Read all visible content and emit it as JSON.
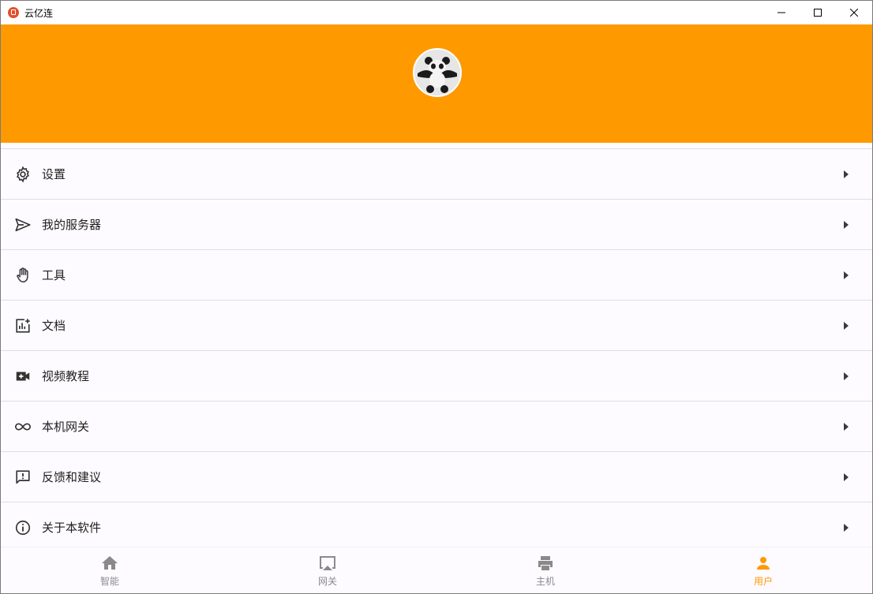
{
  "window": {
    "title": "云亿连",
    "controls": [
      "minimize-icon",
      "maximize-icon",
      "close-icon"
    ]
  },
  "header": {
    "background": "#ff9900",
    "avatar": "panda-avatar"
  },
  "menu": {
    "items": [
      {
        "icon": "gear-icon",
        "label": "设置"
      },
      {
        "icon": "send-icon",
        "label": "我的服务器"
      },
      {
        "icon": "hand-icon",
        "label": "工具"
      },
      {
        "icon": "chart-add-icon",
        "label": "文档"
      },
      {
        "icon": "video-add-icon",
        "label": "视频教程"
      },
      {
        "icon": "infinity-icon",
        "label": "本机网关"
      },
      {
        "icon": "feedback-icon",
        "label": "反馈和建议"
      },
      {
        "icon": "info-icon",
        "label": "关于本软件"
      }
    ]
  },
  "bottom_nav": {
    "items": [
      {
        "icon": "home-icon",
        "label": "智能"
      },
      {
        "icon": "airplay-icon",
        "label": "网关"
      },
      {
        "icon": "printer-icon",
        "label": "主机"
      },
      {
        "icon": "person-icon",
        "label": "用户"
      }
    ],
    "active": "用户",
    "active_color": "#ff9900",
    "inactive_color": "#8a8a8a"
  }
}
